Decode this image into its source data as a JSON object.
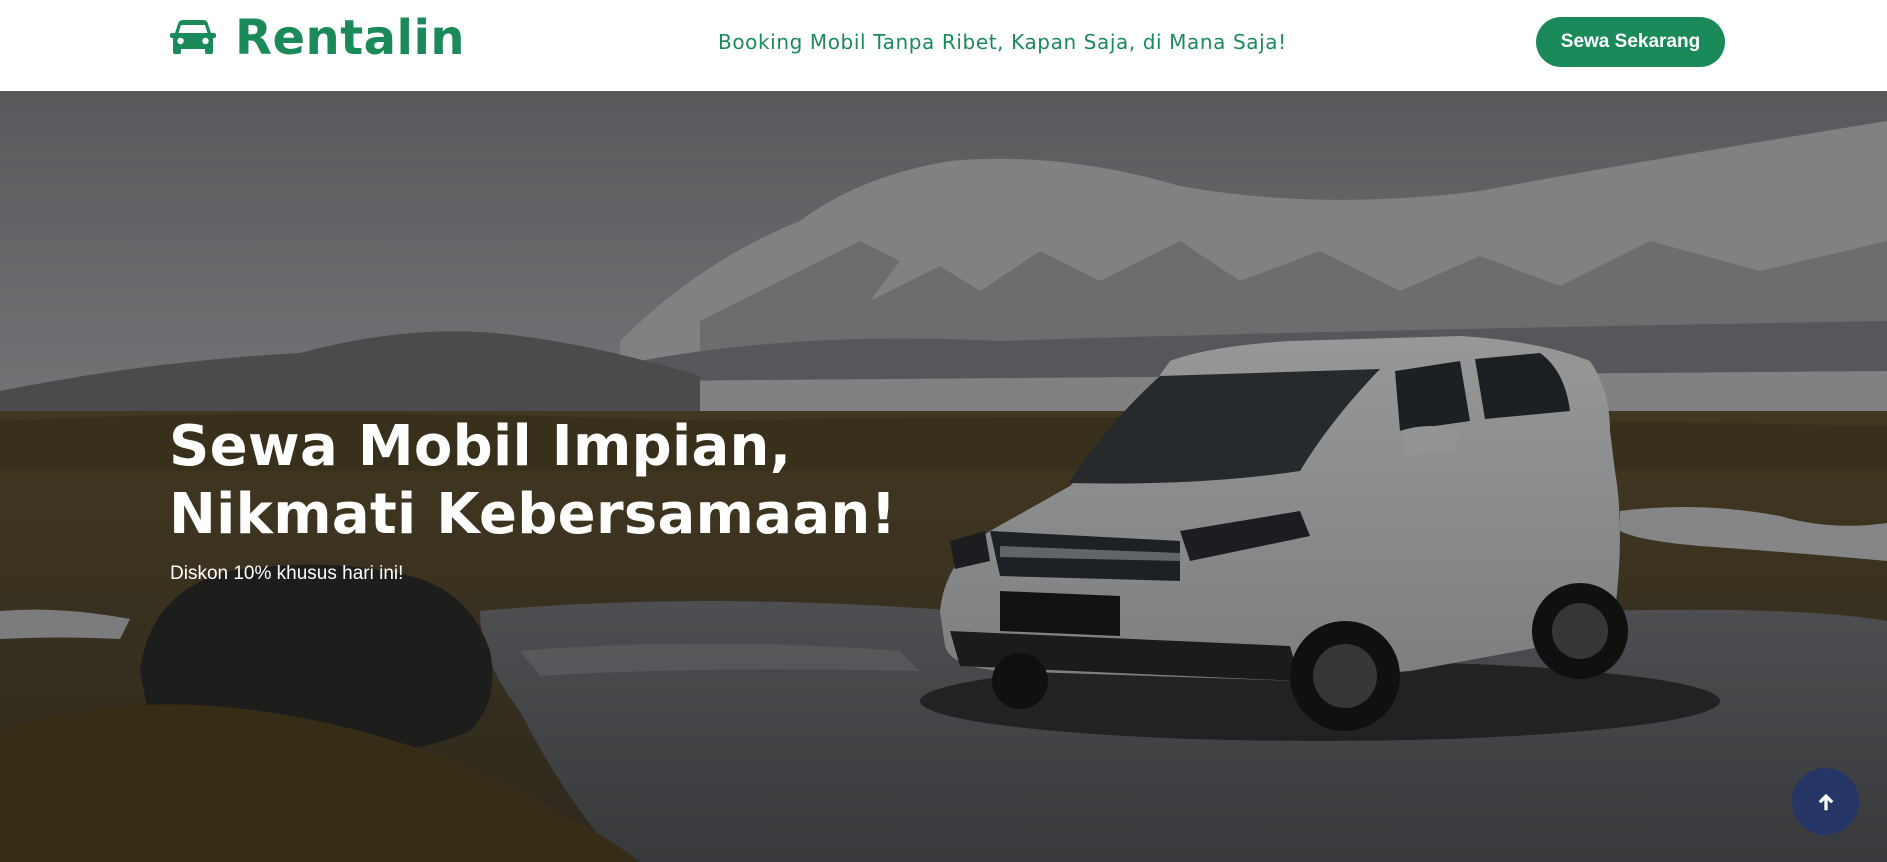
{
  "header": {
    "brand": {
      "name": "Rentalin",
      "icon": "car-icon"
    },
    "tagline": "Booking Mobil Tanpa Ribet, Kapan Saja, di Mana Saja!",
    "cta_label": "Sewa Sekarang"
  },
  "hero": {
    "title_line_1": "Sewa Mobil Impian,",
    "title_line_2": "Nikmati Kebersamaan!",
    "subtitle": "Diskon 10% khusus hari ini!",
    "background_image": "white SUV parked on wet ground in front of snowy mountain"
  },
  "back_to_top": {
    "icon": "arrow-up-icon"
  },
  "colors": {
    "brand_green": "#1b8a5a",
    "back_to_top_bg": "#253565",
    "header_bg": "#ffffff"
  }
}
